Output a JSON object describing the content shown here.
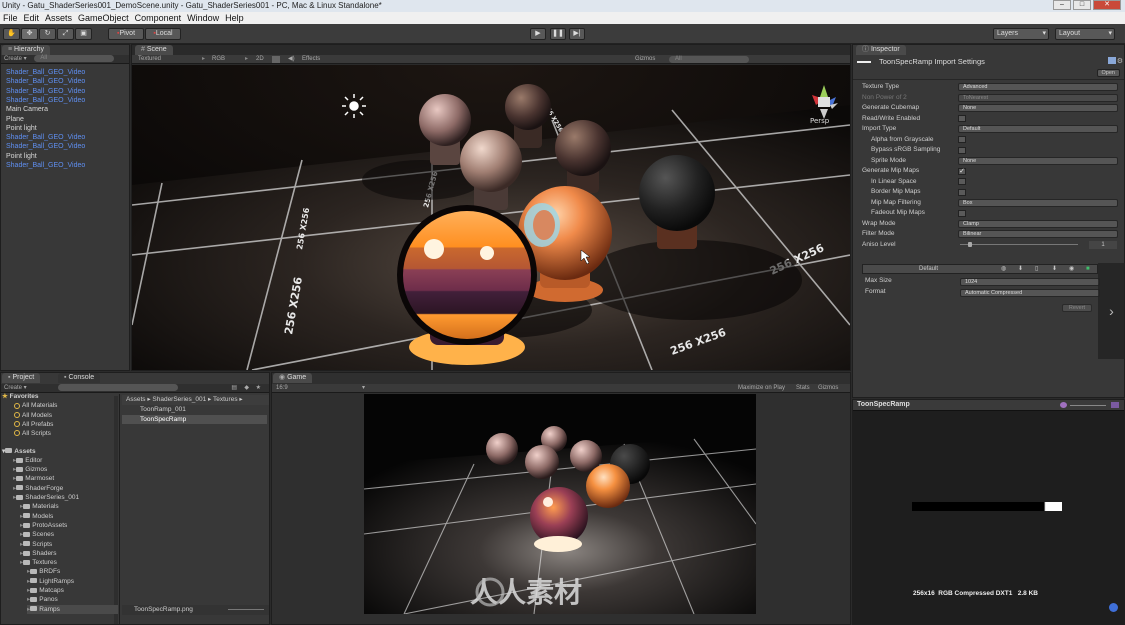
{
  "window": {
    "title": "Unity - Gatu_ShaderSeries001_DemoScene.unity - Gatu_ShaderSeries001 - PC, Mac & Linux Standalone*"
  },
  "menu": [
    "File",
    "Edit",
    "Assets",
    "GameObject",
    "Component",
    "Window",
    "Help"
  ],
  "toolbar": {
    "pivot_label": "Pivot",
    "local_label": "Local",
    "layers_label": "Layers",
    "layout_label": "Layout"
  },
  "hierarchy": {
    "tab_label": "Hierarchy",
    "create_label": "Create",
    "search_placeholder": "All",
    "items": [
      {
        "label": "Shader_Ball_GEO_Video",
        "prefab": true
      },
      {
        "label": "Shader_Ball_GEO_Video",
        "prefab": true
      },
      {
        "label": "Shader_Ball_GEO_Video",
        "prefab": true
      },
      {
        "label": "Shader_Ball_GEO_Video",
        "prefab": true
      },
      {
        "label": "Main Camera",
        "prefab": false
      },
      {
        "label": "Plane",
        "prefab": false
      },
      {
        "label": "Point light",
        "prefab": false
      },
      {
        "label": "Shader_Ball_GEO_Video",
        "prefab": true
      },
      {
        "label": "Shader_Ball_GEO_Video",
        "prefab": true
      },
      {
        "label": "Point light",
        "prefab": false
      },
      {
        "label": "Shader_Ball_GEO_Video",
        "prefab": true
      }
    ]
  },
  "scene": {
    "tab_label": "Scene",
    "shading_mode": "Textured",
    "render_mode": "RGB",
    "toggle_2d": "2D",
    "effects_label": "Effects",
    "gizmos_label": "Gizmos",
    "search_placeholder": "All",
    "persp_label": "Persp",
    "grid_labels": [
      "256 X256",
      "256 X256",
      "256 X256",
      "256 X256",
      "256 X256",
      "256 X256"
    ]
  },
  "inspector": {
    "tab_label": "Inspector",
    "title": "ToonSpecRamp Import Settings",
    "open_label": "Open",
    "fields": [
      {
        "label": "Texture Type",
        "value": "Advanced",
        "kind": "dropdown"
      },
      {
        "label": "Non Power of 2",
        "value": "ToNearest",
        "kind": "dropdown",
        "disabled": true
      },
      {
        "label": "Generate Cubemap",
        "value": "None",
        "kind": "dropdown"
      },
      {
        "label": "Read/Write Enabled",
        "value": "",
        "kind": "checkbox",
        "checked": false
      },
      {
        "label": "Import Type",
        "value": "Default",
        "kind": "dropdown"
      },
      {
        "label": "Alpha from Grayscale",
        "value": "",
        "kind": "checkbox",
        "checked": false,
        "sub": true
      },
      {
        "label": "Bypass sRGB Sampling",
        "value": "",
        "kind": "checkbox",
        "checked": false,
        "sub": true
      },
      {
        "label": "Sprite Mode",
        "value": "None",
        "kind": "dropdown",
        "sub": true
      },
      {
        "label": "Generate Mip Maps",
        "value": "",
        "kind": "checkbox",
        "checked": true
      },
      {
        "label": "In Linear Space",
        "value": "",
        "kind": "checkbox",
        "checked": false,
        "sub": true
      },
      {
        "label": "Border Mip Maps",
        "value": "",
        "kind": "checkbox",
        "checked": false,
        "sub": true
      },
      {
        "label": "Mip Map Filtering",
        "value": "Box",
        "kind": "dropdown",
        "sub": true
      },
      {
        "label": "Fadeout Mip Maps",
        "value": "",
        "kind": "checkbox",
        "checked": false,
        "sub": true
      },
      {
        "label": "Wrap Mode",
        "value": "Clamp",
        "kind": "dropdown"
      },
      {
        "label": "Filter Mode",
        "value": "Bilinear",
        "kind": "dropdown"
      },
      {
        "label": "Aniso Level",
        "value": "1",
        "kind": "slider"
      }
    ],
    "platform": {
      "default_label": "Default",
      "max_size_label": "Max Size",
      "max_size_value": "1024",
      "format_label": "Format",
      "format_value": "Automatic Compressed",
      "revert_label": "Revert"
    }
  },
  "preview": {
    "title": "ToonSpecRamp",
    "info": "256x16  RGB Compressed DXT1   2.8 KB"
  },
  "project": {
    "tab_label": "Project",
    "console_tab_label": "Console",
    "create_label": "Create",
    "breadcrumb": [
      "Assets",
      "ShaderSeries_001",
      "Textures"
    ],
    "favorites_label": "Favorites",
    "favorites": [
      "All Materials",
      "All Models",
      "All Prefabs",
      "All Scripts"
    ],
    "assets_label": "Assets",
    "tree": [
      {
        "label": "Editor",
        "depth": 1
      },
      {
        "label": "Gizmos",
        "depth": 1
      },
      {
        "label": "Marmoset",
        "depth": 1
      },
      {
        "label": "ShaderForge",
        "depth": 1
      },
      {
        "label": "ShaderSeries_001",
        "depth": 1
      },
      {
        "label": "Materials",
        "depth": 2
      },
      {
        "label": "Models",
        "depth": 2
      },
      {
        "label": "ProtoAssets",
        "depth": 2
      },
      {
        "label": "Scenes",
        "depth": 2
      },
      {
        "label": "Scripts",
        "depth": 2
      },
      {
        "label": "Shaders",
        "depth": 2
      },
      {
        "label": "Textures",
        "depth": 2
      },
      {
        "label": "BRDFs",
        "depth": 3
      },
      {
        "label": "LightRamps",
        "depth": 3
      },
      {
        "label": "Matcaps",
        "depth": 3
      },
      {
        "label": "Panos",
        "depth": 3
      },
      {
        "label": "Ramps",
        "depth": 3
      }
    ],
    "files": [
      "ToonRamp_001",
      "ToonSpecRamp"
    ],
    "selected_file_footer": "ToonSpecRamp.png"
  },
  "game": {
    "tab_label": "Game",
    "aspect": "16:9",
    "maximize_label": "Maximize on Play",
    "stats_label": "Stats",
    "gizmos_label": "Gizmos",
    "watermark": "人人素材"
  },
  "colors": {
    "prefab_blue": "#5f8ff1",
    "panel_bg": "#383838",
    "selection": "#3e5f96"
  }
}
